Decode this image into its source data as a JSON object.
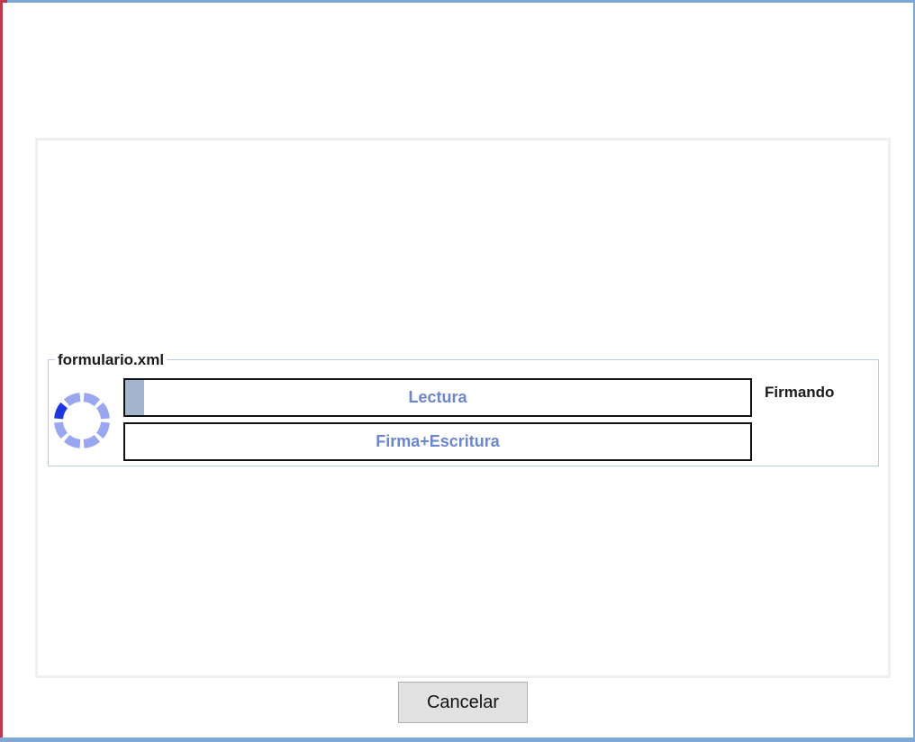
{
  "group": {
    "title": "formulario.xml",
    "status": "Firmando"
  },
  "progress": {
    "read": {
      "label": "Lectura",
      "fraction": 0.03
    },
    "write": {
      "label": "Firma+Escritura",
      "fraction": 0.0
    }
  },
  "spinner": {
    "icon": "loading-spinner-icon",
    "active_color": "#1f35e0",
    "idle_color": "#9aa6f0",
    "segments": 8,
    "active_segment": 6
  },
  "buttons": {
    "cancel_label": "Cancelar"
  },
  "colors": {
    "bar_fill": "#a3b6cd",
    "bar_text": "#6b86cf",
    "group_border": "#b7cde6"
  }
}
